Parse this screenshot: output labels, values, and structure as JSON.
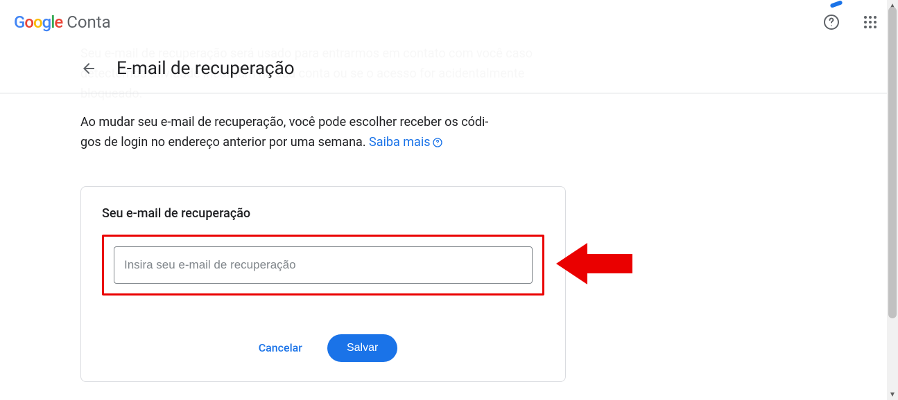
{
  "header": {
    "logo_text": "Google",
    "account_text": "Conta"
  },
  "page": {
    "title": "E-mail de recuperação",
    "faded_description": "Seu e-mail de recuperação será usado para entrarmos em contato com você caso detectemos atividade incomum na sua conta ou se o acesso for acidentalmente bloqueado.",
    "description_part1": "Ao mudar seu e-mail de recuperação, você pode escolher receber os códi-",
    "description_part2": "gos de login no endereço anterior por uma semana. ",
    "learn_more": "Saiba mais"
  },
  "card": {
    "title": "Seu e-mail de recuperação",
    "input_placeholder": "Insira seu e-mail de recuperação",
    "cancel_label": "Cancelar",
    "save_label": "Salvar"
  }
}
